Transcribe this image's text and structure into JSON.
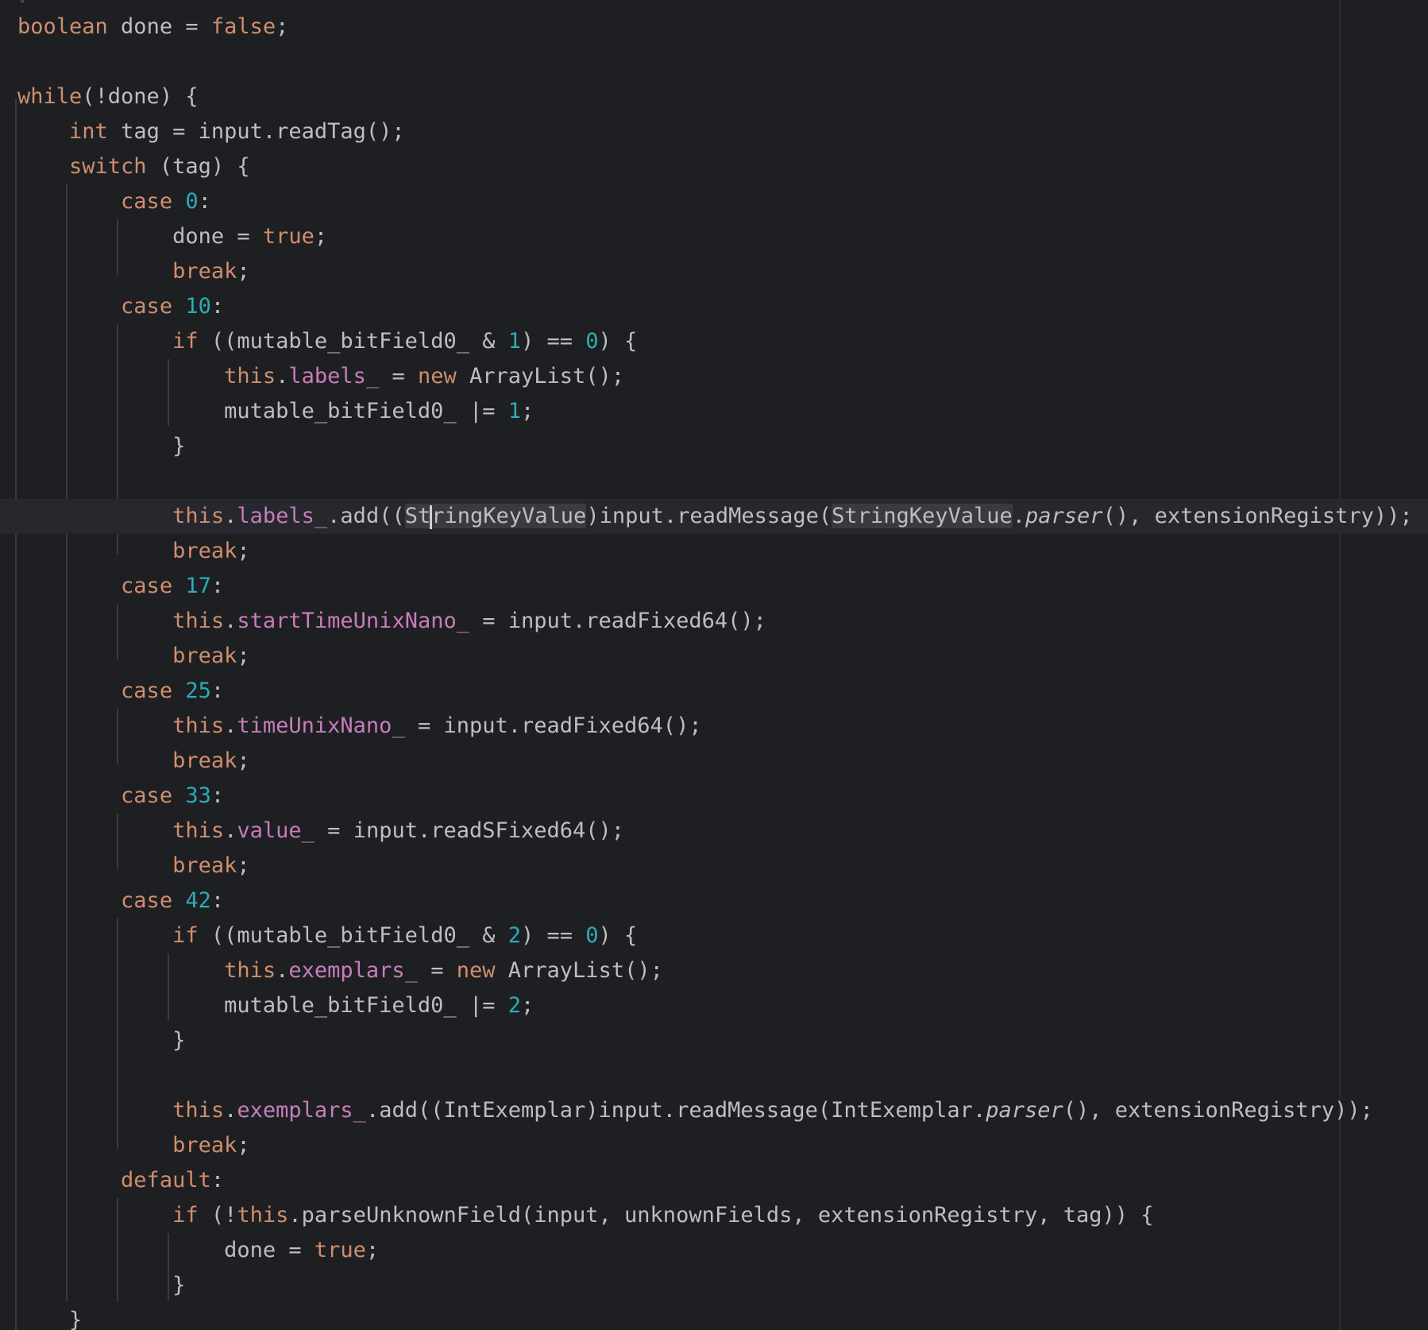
{
  "editor": {
    "language": "Java",
    "colors": {
      "background": "#1e1f22",
      "text": "#bcbec4",
      "keyword": "#cf8e6d",
      "number": "#2aacb8",
      "field": "#c77dbb",
      "current_line": "#26282e",
      "usage_highlight": "#393b40"
    },
    "lines": [
      "boolean done = false;",
      "",
      "while(!done) {",
      "    int tag = input.readTag();",
      "    switch (tag) {",
      "        case 0:",
      "            done = true;",
      "            break;",
      "        case 10:",
      "            if ((mutable_bitField0_ & 1) == 0) {",
      "                this.labels_ = new ArrayList();",
      "                mutable_bitField0_ |= 1;",
      "            }",
      "",
      "            this.labels_.add((StringKeyValue)input.readMessage(StringKeyValue.parser(), extensionRegistry));",
      "            break;",
      "        case 17:",
      "            this.startTimeUnixNano_ = input.readFixed64();",
      "            break;",
      "        case 25:",
      "            this.timeUnixNano_ = input.readFixed64();",
      "            break;",
      "        case 33:",
      "            this.value_ = input.readSFixed64();",
      "            break;",
      "        case 42:",
      "            if ((mutable_bitField0_ & 2) == 0) {",
      "                this.exemplars_ = new ArrayList();",
      "                mutable_bitField0_ |= 2;",
      "            }",
      "",
      "            this.exemplars_.add((IntExemplar)input.readMessage(IntExemplar.parser(), extensionRegistry));",
      "            break;",
      "        default:",
      "            if (!this.parseUnknownField(input, unknownFields, extensionRegistry, tag)) {",
      "                done = true;",
      "            }",
      "    }"
    ],
    "current_line_index": 14,
    "highlighted_word": "StringKeyValue"
  }
}
